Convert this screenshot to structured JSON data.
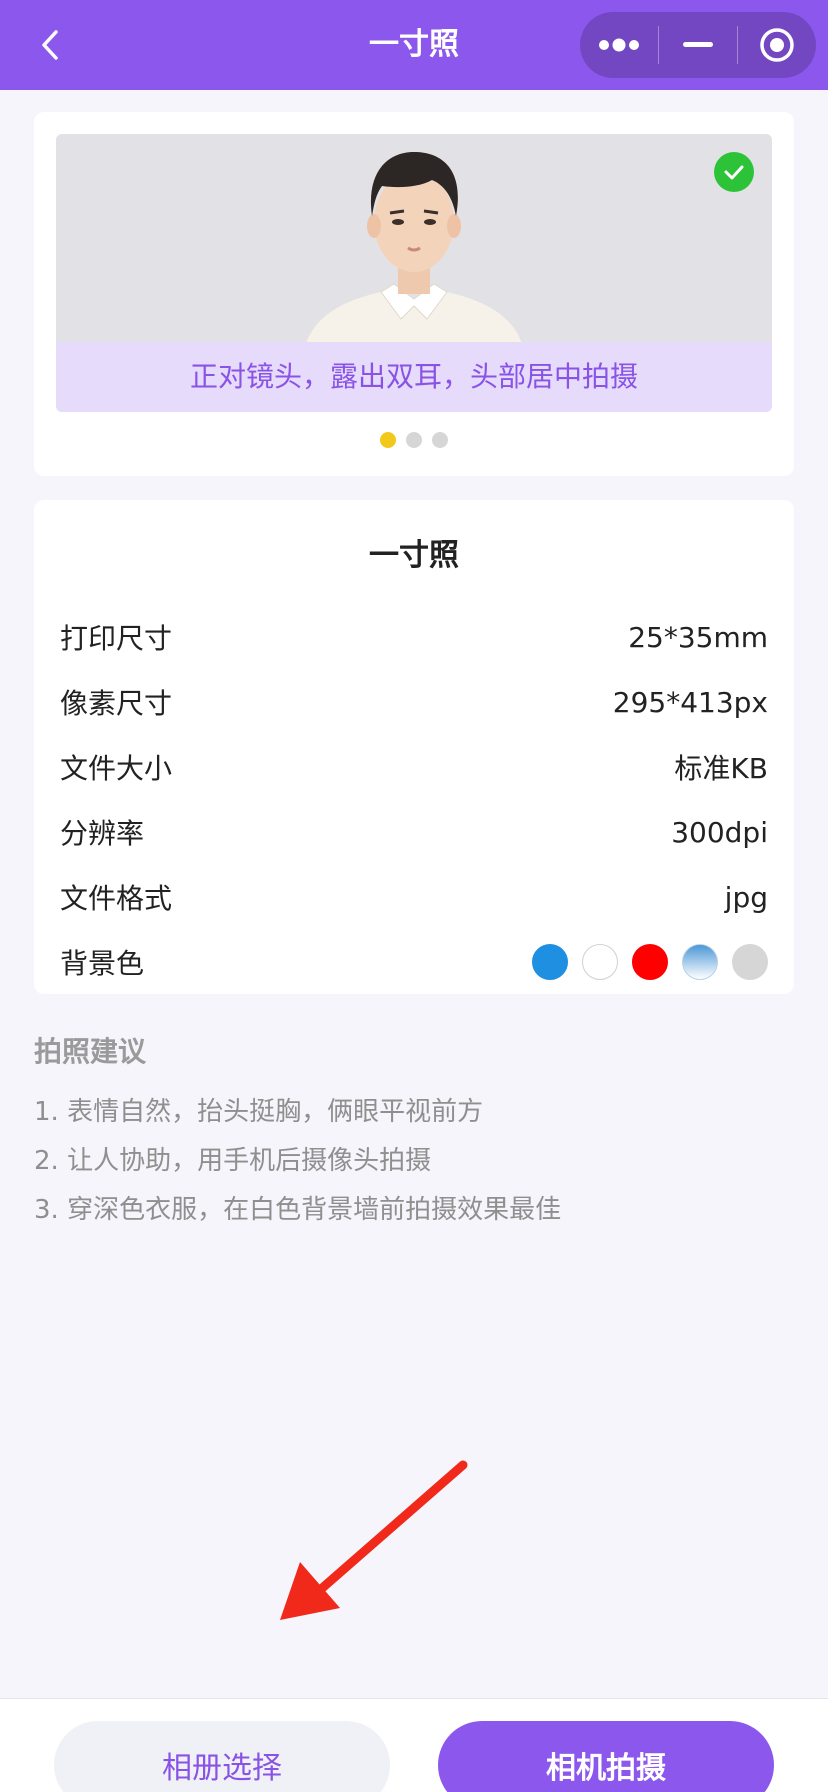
{
  "header": {
    "title": "一寸照",
    "back_icon": "chevron-left-icon",
    "more_icon": "more-dots-icon",
    "minimize_icon": "minimize-icon",
    "close_icon": "target-close-icon"
  },
  "carousel": {
    "caption": "正对镜头，露出双耳，头部居中拍摄",
    "dots": [
      true,
      false,
      false
    ],
    "status_icon": "check-icon"
  },
  "info": {
    "title": "一寸照",
    "rows": [
      {
        "label": "打印尺寸",
        "value": "25*35mm"
      },
      {
        "label": "像素尺寸",
        "value": "295*413px"
      },
      {
        "label": "文件大小",
        "value": "标准KB"
      },
      {
        "label": "分辨率",
        "value": "300dpi"
      },
      {
        "label": "文件格式",
        "value": "jpg"
      }
    ],
    "bg_label": "背景色",
    "bg_colors": [
      "#1e8fe1",
      "#ffffff",
      "#ff0000",
      "gradient-blue",
      "#d6d6d6"
    ]
  },
  "tips": {
    "title": "拍照建议",
    "items": [
      "1. 表情自然，抬头挺胸，俩眼平视前方",
      "2. 让人协助，用手机后摄像头拍摄",
      "3. 穿深色衣服，在白色背景墙前拍摄效果最佳"
    ]
  },
  "buttons": {
    "album": "相册选择",
    "camera": "相机拍摄"
  },
  "colors": {
    "primary": "#8c57ec",
    "caption_bg": "#e7dbfc",
    "arrow": "#f0291a"
  }
}
